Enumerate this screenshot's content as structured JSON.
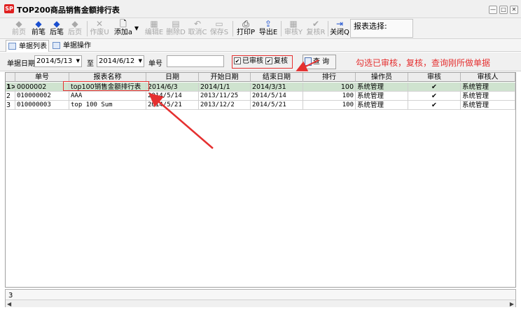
{
  "window": {
    "app_icon": "SP",
    "title": "TOP200商品销售金额排行表",
    "controls": [
      "—",
      "□",
      "✕"
    ]
  },
  "toolbar": {
    "buttons": [
      {
        "label": "前页",
        "icon": "arrow-left-icon",
        "glyph": "◆",
        "enabled": false
      },
      {
        "label": "前笔",
        "icon": "arrow-up-icon",
        "glyph": "◆",
        "enabled": true
      },
      {
        "label": "后笔",
        "icon": "arrow-down-icon",
        "glyph": "◆",
        "enabled": true
      },
      {
        "label": "后页",
        "icon": "arrow-right-icon",
        "glyph": "◆",
        "enabled": false
      },
      {
        "label": "作废U",
        "icon": "void-icon",
        "glyph": "✕",
        "enabled": false
      },
      {
        "label": "添加a",
        "icon": "new-document-icon",
        "glyph": "🗋",
        "enabled": true
      },
      {
        "label": "编辑E",
        "icon": "edit-icon",
        "glyph": "▦",
        "enabled": false
      },
      {
        "label": "删除D",
        "icon": "delete-icon",
        "glyph": "▤",
        "enabled": false
      },
      {
        "label": "取消C",
        "icon": "undo-icon",
        "glyph": "↶",
        "enabled": false
      },
      {
        "label": "保存S",
        "icon": "save-icon",
        "glyph": "▭",
        "enabled": false
      },
      {
        "label": "打印P",
        "icon": "printer-icon",
        "glyph": "⎙",
        "enabled": true
      },
      {
        "label": "导出E",
        "icon": "export-icon",
        "glyph": "⇪",
        "enabled": true
      },
      {
        "label": "审核Y",
        "icon": "audit-icon",
        "glyph": "▦",
        "enabled": false
      },
      {
        "label": "复核R",
        "icon": "recheck-icon",
        "glyph": "✔",
        "enabled": false
      },
      {
        "label": "关闭Q",
        "icon": "close-door-icon",
        "glyph": "⇥",
        "enabled": true
      }
    ],
    "add_dropdown_glyph": "▾",
    "report_select_label": "报表选择:"
  },
  "tabs": [
    {
      "label": "单据列表",
      "active": true
    },
    {
      "label": "单据操作",
      "active": false
    }
  ],
  "filter": {
    "date_label": "单据日期",
    "date_from": "2014/5/13",
    "to_label": "至",
    "date_to": "2014/6/12",
    "doc_no_label": "单号",
    "doc_no_value": "",
    "approved_label": "已审核",
    "approved_checked": true,
    "rechecked_label": "复核",
    "rechecked_checked": true,
    "query_label": "查 询",
    "annotation": "勾选已审核，复核，查询刚所做单据"
  },
  "grid": {
    "columns": [
      "单号",
      "报表名称",
      "日期",
      "开始日期",
      "结束日期",
      "排行",
      "操作员",
      "审核",
      "审核人"
    ],
    "rows": [
      {
        "idx": "1",
        "marker": "1>",
        "doc_no": "0000002",
        "name": "top100销售金额排行表",
        "date": "2014/6/3",
        "start": "2014/1/1",
        "end": "2014/3/31",
        "rank": "100",
        "operator": "系统管理",
        "approved": "✔",
        "approver": "系统管理",
        "selected": true
      },
      {
        "idx": "2",
        "marker": "2",
        "doc_no": "010000002",
        "name": "AAA",
        "date": "2014/5/14",
        "start": "2013/11/25",
        "end": "2014/5/14",
        "rank": "100",
        "operator": "系统管理",
        "approved": "✔",
        "approver": "系统管理",
        "selected": false
      },
      {
        "idx": "3",
        "marker": "3",
        "doc_no": "010000003",
        "name": "top 100 Sum",
        "date": "2014/5/21",
        "start": "2013/12/2",
        "end": "2014/5/21",
        "rank": "100",
        "operator": "系统管理",
        "approved": "✔",
        "approver": "系统管理",
        "selected": false
      }
    ],
    "record_count": "3"
  },
  "colors": {
    "annotation_red": "#e53030",
    "selected_row": "#cfe3cf",
    "toolbar_blue": "#1a4fd0"
  }
}
